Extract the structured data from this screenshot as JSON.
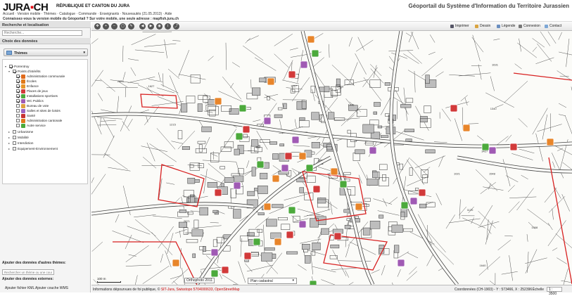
{
  "header": {
    "logo_left": "JURA",
    "logo_right": "CH",
    "republic": "RÉPUBLIQUE ET CANTON DU JURA",
    "nav": "Accueil · Version mobile · Thèmes · Catalogue · Commande · Enseignants · Nouveautés (21.05.2013) · Aide",
    "notice": "Connaissez-vous la version mobile du Géoportail ? Sur votre mobile, une seule adresse : mapfish.jura.ch",
    "geoportal": "Géoportail du Système d'Information du Territoire Jurassien"
  },
  "sidebar": {
    "search_title": "Recherche et localisation",
    "search_placeholder": "Recherche...",
    "data_title": "Choix des données",
    "theme_select": "Thèmes",
    "tree": [
      {
        "label": "Porrentruy",
        "level": 0,
        "checked": true,
        "color": ""
      },
      {
        "label": "Points d'intérêts",
        "level": 1,
        "checked": true,
        "color": ""
      },
      {
        "label": "Administration communale",
        "level": 2,
        "checked": true,
        "color": "#e06a1b"
      },
      {
        "label": "Écoles",
        "level": 2,
        "checked": true,
        "color": "#e07a1b"
      },
      {
        "label": "Enfance",
        "level": 2,
        "checked": true,
        "color": "#e8962a"
      },
      {
        "label": "Places de jeux",
        "level": 2,
        "checked": true,
        "color": "#d23a3a"
      },
      {
        "label": "Installations sportives",
        "level": 2,
        "checked": true,
        "color": "#4caa3c"
      },
      {
        "label": "WC Publics",
        "level": 2,
        "checked": true,
        "color": "#a05ab4"
      },
      {
        "label": "Bureau de vote",
        "level": 2,
        "checked": false,
        "color": "#e0a040"
      },
      {
        "label": "Salles et sites de loisirs",
        "level": 2,
        "checked": false,
        "color": "#9c64c0"
      },
      {
        "label": "Santé",
        "level": 2,
        "checked": false,
        "color": "#c83232"
      },
      {
        "label": "Administration cantonale",
        "level": 2,
        "checked": false,
        "color": "#e07a1b"
      },
      {
        "label": "Autre service",
        "level": 2,
        "checked": false,
        "color": "#4caa3c"
      },
      {
        "label": "Urbanisme",
        "level": 1,
        "checked": false,
        "color": ""
      },
      {
        "label": "Mobilité",
        "level": 1,
        "checked": false,
        "color": ""
      },
      {
        "label": "Interdiction",
        "level": 1,
        "checked": false,
        "color": ""
      },
      {
        "label": "Equipement-Environnement",
        "level": 1,
        "checked": false,
        "color": ""
      }
    ],
    "add_other": "Ajouter des données d'autres thèmes:",
    "other_placeholder": "Rechercher un thème ou une couche",
    "add_external": "Ajouter des données externes:",
    "kml": "Ajouter fichier KML",
    "wms": "Ajouter couche WMS"
  },
  "toolbar": {
    "print": "Imprimer",
    "draw": "Dessin",
    "legend": "Légende",
    "login": "Connexion",
    "contact": "Contact"
  },
  "map": {
    "orthophoto": "Orthophoto 2011",
    "plan": "Plan cadastral",
    "scale_label": "100 m"
  },
  "footer": {
    "attribution_a": "Informations dépourvues de foi publique, ©",
    "attribution_b": "SIT-Jura, Swisstopo 5704000633, OpenStreetMap",
    "coords": "Coordonnées (CH-1903) - Y : 573466, X : 252396",
    "scale_prefix": "Échelle",
    "scale": "1 : 3500"
  },
  "colors": {
    "accent": "#e30613",
    "orange": "#e8852a",
    "green": "#4caa3c",
    "purple": "#a05ab4",
    "red": "#d23a3a"
  }
}
